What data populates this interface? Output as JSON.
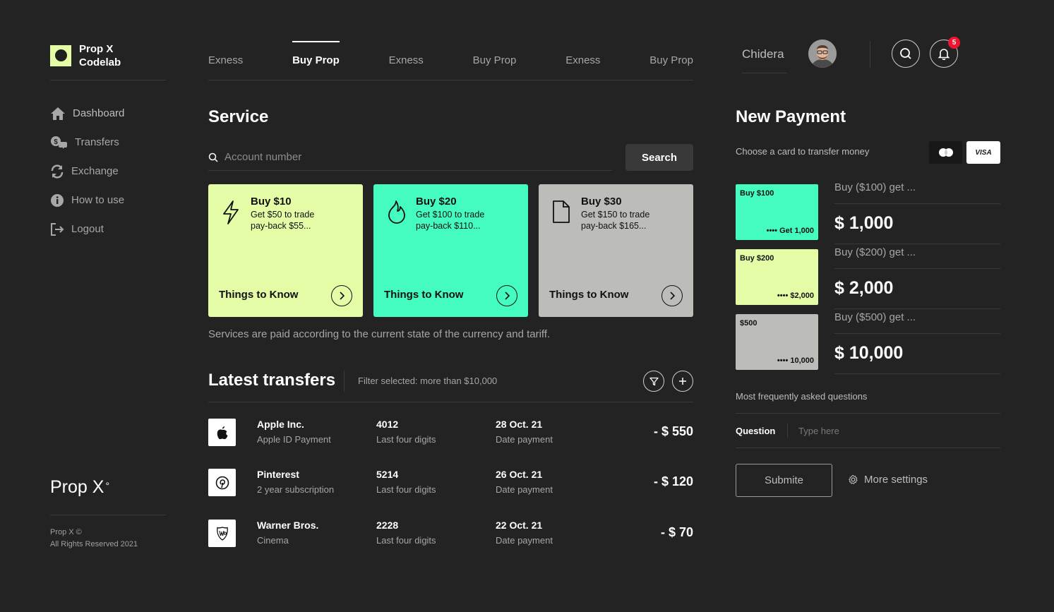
{
  "colors": {
    "bg": "#232323",
    "lime": "#e4fca6",
    "mint": "#44fcbf",
    "gray": "#bcbcb8",
    "badge": "#f0142f"
  },
  "sidebar": {
    "brand": {
      "line1": "Prop X",
      "line2": "Codelab"
    },
    "items": [
      {
        "label": "Dashboard",
        "icon": "home-icon"
      },
      {
        "label": "Transfers",
        "icon": "transfers-icon"
      },
      {
        "label": "Exchange",
        "icon": "exchange-icon"
      },
      {
        "label": "How to use",
        "icon": "info-icon"
      },
      {
        "label": "Logout",
        "icon": "logout-icon"
      }
    ],
    "brand_big": "Prop X",
    "brand_big_sup": "°",
    "copyright_line1": "Prop X ©",
    "copyright_line2": "All Rights Reserved 2021"
  },
  "tabs": [
    {
      "label": "Exness"
    },
    {
      "label": "Buy Prop",
      "active": true
    },
    {
      "label": "Exness"
    },
    {
      "label": "Buy Prop"
    },
    {
      "label": "Exness"
    },
    {
      "label": "Buy Prop"
    }
  ],
  "header": {
    "user_name": "Chidera",
    "notification_count": "5"
  },
  "service": {
    "title": "Service",
    "search_placeholder": "Account number",
    "search_button": "Search",
    "cards": [
      {
        "title": "Buy $10",
        "desc1": "Get $50 to trade",
        "desc2": "pay-back $55...",
        "cta": "Things to Know",
        "icon": "lightning-icon"
      },
      {
        "title": "Buy $20",
        "desc1": "Get $100 to trade",
        "desc2": "pay-back $110...",
        "cta": "Things to Know",
        "icon": "flame-icon"
      },
      {
        "title": "Buy $30",
        "desc1": "Get $150 to trade",
        "desc2": "pay-back $165...",
        "cta": "Things to Know",
        "icon": "document-icon"
      }
    ],
    "note": "Services are paid according to the current state of the currency and tariff."
  },
  "latest": {
    "title": "Latest transfers",
    "filter": "Filter selected: more than $10,000",
    "rows": [
      {
        "name": "Apple Inc.",
        "sub": "Apple ID Payment",
        "digits": "4012",
        "digits_label": "Last four digits",
        "date": "28 Oct. 21",
        "date_label": "Date payment",
        "amount": "- $ 550",
        "icon": "apple-icon"
      },
      {
        "name": "Pinterest",
        "sub": "2 year subscription",
        "digits": "5214",
        "digits_label": "Last four digits",
        "date": "26 Oct. 21",
        "date_label": "Date payment",
        "amount": "- $ 120",
        "icon": "pinterest-icon"
      },
      {
        "name": "Warner Bros.",
        "sub": "Cinema",
        "digits": "2228",
        "digits_label": "Last four digits",
        "date": "22 Oct. 21",
        "date_label": "Date payment",
        "amount": "- $ 70",
        "icon": "warner-icon"
      }
    ]
  },
  "payment": {
    "title": "New Payment",
    "choose": "Choose a card to transfer money",
    "visa": "VISA",
    "cards": [
      {
        "label": "Buy $100",
        "bottom": "•••• Get 1,000",
        "buy": "Buy ($100) get ...",
        "amount": "$ 1,000"
      },
      {
        "label": "Buy $200",
        "bottom": "•••• $2,000",
        "buy": "Buy ($200) get ...",
        "amount": "$ 2,000"
      },
      {
        "label": "$500",
        "bottom": "•••• 10,000",
        "buy": "Buy ($500) get ...",
        "amount": "$ 10,000"
      }
    ],
    "faq": "Most frequently asked questions",
    "question_label": "Question",
    "question_placeholder": "Type here",
    "submit": "Submite",
    "more_settings": "More settings"
  }
}
